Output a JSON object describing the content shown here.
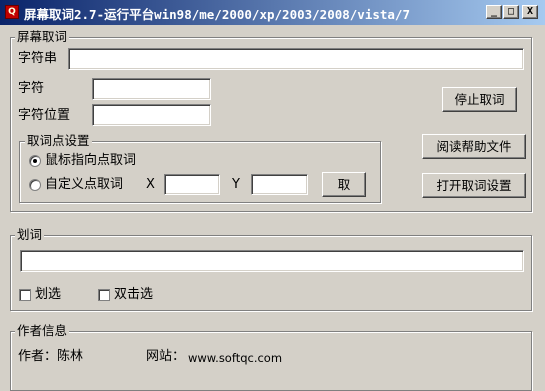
{
  "window": {
    "title": "屏幕取词2.7-运行平台win98/me/2000/xp/2003/2008/vista/7",
    "icon_text": "Q",
    "minimize": "_",
    "maximize": "□",
    "close": "X"
  },
  "capture": {
    "legend": "屏幕取词",
    "string_label": "字符串",
    "string_value": "",
    "char_label": "字符",
    "char_value": "",
    "pos_label": "字符位置",
    "pos_value": "",
    "stop_button": "停止取词",
    "help_button": "阅读帮助文件",
    "settings_button": "打开取词设置",
    "point_group": {
      "legend": "取词点设置",
      "mouse_option": "鼠标指向点取词",
      "custom_option": "自定义点取词",
      "x_label": "X",
      "x_value": "",
      "y_label": "Y",
      "y_value": "",
      "pick_button": "取",
      "selected": "mouse"
    }
  },
  "selection": {
    "legend": "划词",
    "text_value": "",
    "select_option": "划选",
    "dblclick_option": "双击选"
  },
  "author": {
    "legend": "作者信息",
    "author_label": "作者：陈林",
    "site_label": "网站：",
    "site_url": "www.softqc.com"
  }
}
